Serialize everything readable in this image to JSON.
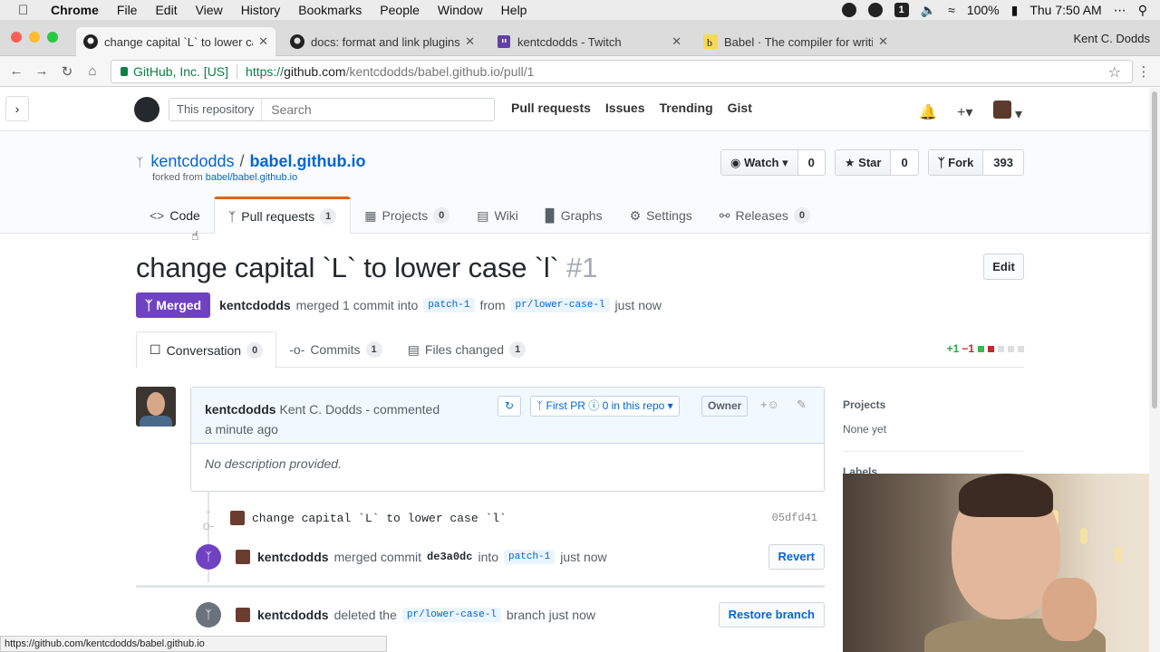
{
  "menubar": {
    "app": "Chrome",
    "items": [
      "File",
      "Edit",
      "View",
      "History",
      "Bookmarks",
      "People",
      "Window",
      "Help"
    ],
    "badge": "1",
    "battery": "100%",
    "clock": "Thu 7:50 AM"
  },
  "tabs": [
    {
      "title": "change capital `L` to lower case `l`",
      "icon": "github-icon",
      "active": true
    },
    {
      "title": "docs: format and link plugins by kentcdodds",
      "icon": "github-icon",
      "active": false
    },
    {
      "title": "kentcdodds - Twitch",
      "icon": "twitch-icon",
      "active": false
    },
    {
      "title": "Babel · The compiler for writing next generation JavaScript",
      "icon": "babel-icon",
      "active": false
    }
  ],
  "profile": "Kent C. Dodds",
  "address": {
    "secure_label": "GitHub, Inc. [US]",
    "url_scheme": "https://",
    "url_host": "github.com",
    "url_path": "/kentcdodds/babel.github.io/pull/1"
  },
  "gh_header": {
    "scope": "This repository",
    "search_placeholder": "Search",
    "nav": [
      "Pull requests",
      "Issues",
      "Trending",
      "Gist"
    ]
  },
  "repo": {
    "owner": "kentcdodds",
    "name": "babel.github.io",
    "forked_from_prefix": "forked from",
    "forked_from": "babel/babel.github.io",
    "watch_label": "Watch",
    "watch_count": "0",
    "star_label": "Star",
    "star_count": "0",
    "fork_label": "Fork",
    "fork_count": "393",
    "nav": [
      {
        "label": "Code",
        "count": ""
      },
      {
        "label": "Pull requests",
        "count": "1"
      },
      {
        "label": "Projects",
        "count": "0"
      },
      {
        "label": "Wiki",
        "count": ""
      },
      {
        "label": "Graphs",
        "count": ""
      },
      {
        "label": "Settings",
        "count": ""
      },
      {
        "label": "Releases",
        "count": "0"
      }
    ]
  },
  "pr": {
    "title": "change capital `L` to lower case `l`",
    "number": "#1",
    "edit_label": "Edit",
    "state": "Merged",
    "author": "kentcdodds",
    "merged_text": "merged 1 commit into",
    "base": "patch-1",
    "from_text": "from",
    "head": "pr/lower-case-l",
    "when": "just now",
    "tabs": [
      {
        "label": "Conversation",
        "count": "0"
      },
      {
        "label": "Commits",
        "count": "1"
      },
      {
        "label": "Files changed",
        "count": "1"
      }
    ],
    "additions": "+1",
    "deletions": "−1"
  },
  "comment": {
    "author": "kentcdodds",
    "full_name": "Kent C. Dodds",
    "action": "- commented",
    "time": "a minute ago",
    "first_pr": "First PR",
    "in_repo": "0 in this repo",
    "role": "Owner",
    "body": "No description provided."
  },
  "timeline": {
    "commit_message": "change capital `L` to lower case `l`",
    "commit_sha": "05dfd41",
    "merge_author": "kentcdodds",
    "merge_text": "merged commit",
    "merge_sha": "de3a0dc",
    "merge_into": "into",
    "merge_base": "patch-1",
    "merge_when": "just now",
    "revert_label": "Revert",
    "delete_author": "kentcdodds",
    "delete_text": "deleted the",
    "delete_branch": "pr/lower-case-l",
    "delete_when": "branch just now",
    "restore_label": "Restore branch"
  },
  "sidebar": {
    "projects_label": "Projects",
    "projects_value": "None yet",
    "labels_label": "Labels"
  },
  "status_url": "https://github.com/kentcdodds/babel.github.io",
  "colors": {
    "merged": "#6f42c1",
    "link": "#0366d6",
    "accent_tab": "#e36209",
    "additions": "#28a745",
    "deletions": "#cb2431"
  }
}
